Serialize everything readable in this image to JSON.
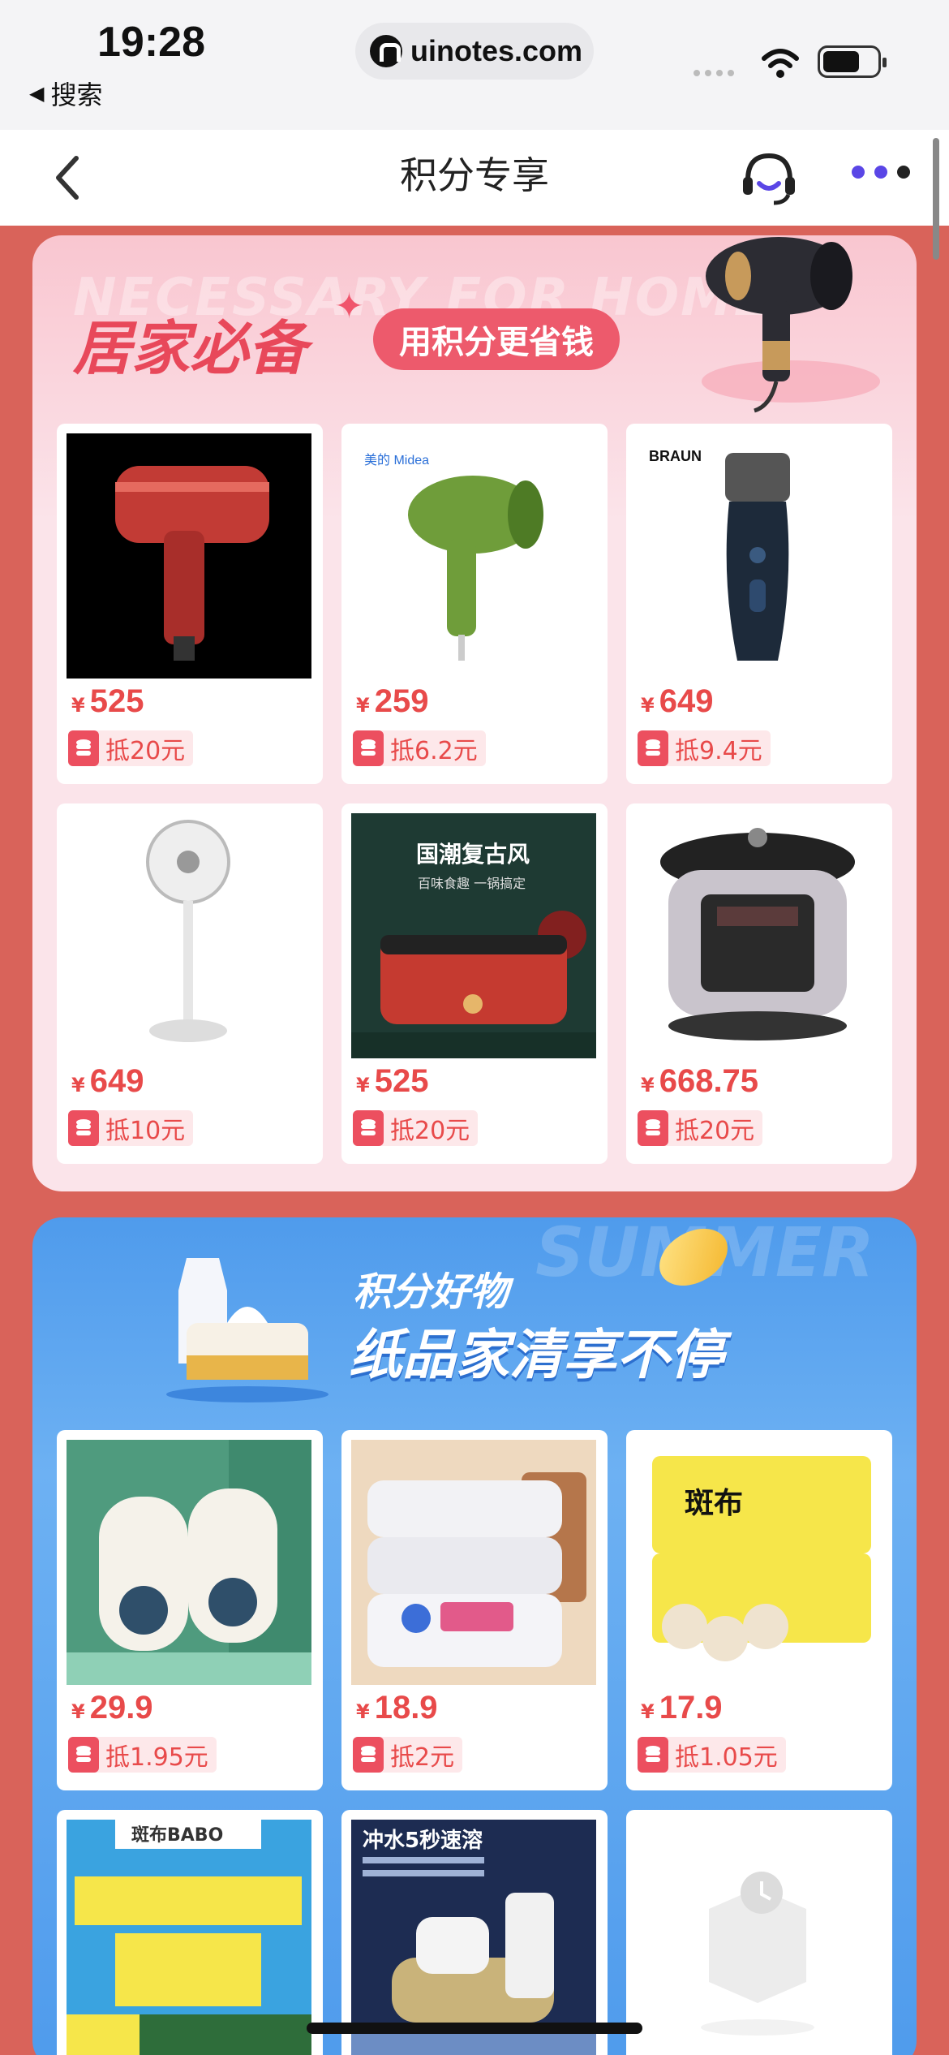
{
  "status": {
    "time": "19:28",
    "back_label": "搜索",
    "url": "uinotes.com"
  },
  "nav": {
    "title": "积分专享"
  },
  "home_section": {
    "ghost": "NECESSARY FOR HOME",
    "title": "居家必备",
    "pill": "用积分更省钱",
    "products": [
      {
        "price": "525",
        "deduct": "抵20元",
        "image": "red-hair-dryer"
      },
      {
        "price": "259",
        "deduct": "抵6.2元",
        "image": "green-hair-dryer"
      },
      {
        "price": "649",
        "deduct": "抵9.4元",
        "image": "electric-shaver"
      },
      {
        "price": "649",
        "deduct": "抵10元",
        "image": "standing-fan"
      },
      {
        "price": "525",
        "deduct": "抵20元",
        "image": "electric-hot-pot"
      },
      {
        "price": "668.75",
        "deduct": "抵20元",
        "image": "pressure-cooker"
      }
    ]
  },
  "paper_section": {
    "ghost": "SUMMER",
    "subtitle": "积分好物",
    "title": "纸品家清享不停",
    "products": [
      {
        "price": "29.9",
        "deduct": "抵1.95元",
        "image": "cotton-towel-rolls"
      },
      {
        "price": "18.9",
        "deduct": "抵2元",
        "image": "kitchen-wet-wipes"
      },
      {
        "price": "17.9",
        "deduct": "抵1.05元",
        "image": "toilet-paper-pack"
      },
      {
        "image": "bamboo-tissue-pack"
      },
      {
        "image": "drain-cleaner"
      },
      {
        "image": "placeholder-box"
      }
    ]
  },
  "colors": {
    "accent_red": "#e84a4a",
    "pink_bg": "#fbe4ea",
    "blue_bg": "#4f9bec",
    "page_bg": "#d9635a"
  },
  "currency": "¥"
}
